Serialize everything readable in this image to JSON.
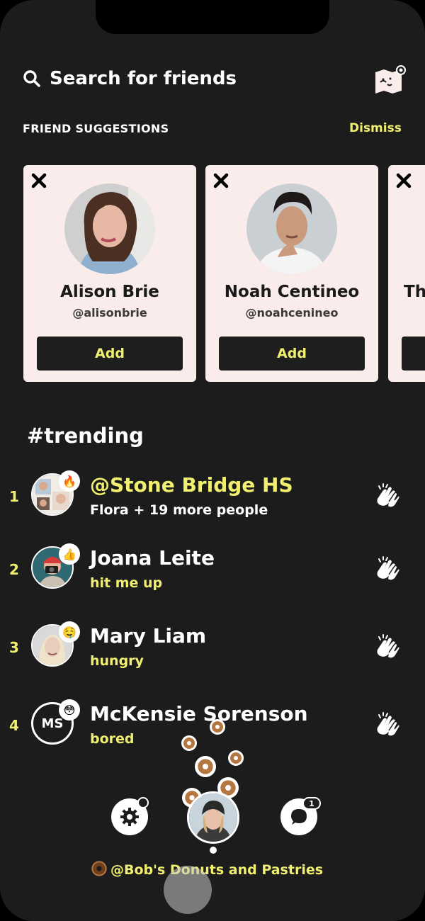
{
  "search": {
    "placeholder": "Search for friends"
  },
  "suggestions": {
    "title": "FRIEND SUGGESTIONS",
    "dismiss_label": "Dismiss",
    "cards": [
      {
        "name": "Alison Brie",
        "handle": "@alisonbrie",
        "add_label": "Add"
      },
      {
        "name": "Noah Centineo",
        "handle": "@noahcenineo",
        "add_label": "Add"
      },
      {
        "name": "Th",
        "handle": "",
        "add_label": ""
      }
    ]
  },
  "trending": {
    "title": "#trending",
    "rows": [
      {
        "rank": "1",
        "name": "@Stone Bridge HS",
        "sub": "Flora + 19 more people",
        "badge_icon": "fire-emoji",
        "badge": "🔥"
      },
      {
        "rank": "2",
        "name": "Joana Leite",
        "sub": "hit me up",
        "badge_icon": "thumbs-up-emoji",
        "badge": "👍"
      },
      {
        "rank": "3",
        "name": "Mary Liam",
        "sub": "hungry",
        "badge_icon": "drooling-face-emoji",
        "badge": "🤤"
      },
      {
        "rank": "4",
        "name": "McKensie Sorenson",
        "sub": "bored",
        "avatar_initials": "MS",
        "badge_icon": "flushed-face-emoji",
        "badge": "😳"
      }
    ]
  },
  "bottom_bar": {
    "chat_count": "1",
    "location": "@Bob's Donuts and Pastries",
    "location_icon": "donut-icon"
  },
  "colors": {
    "accent": "#f1ef6f",
    "background": "#1c1c1c",
    "card": "#fbecec"
  }
}
